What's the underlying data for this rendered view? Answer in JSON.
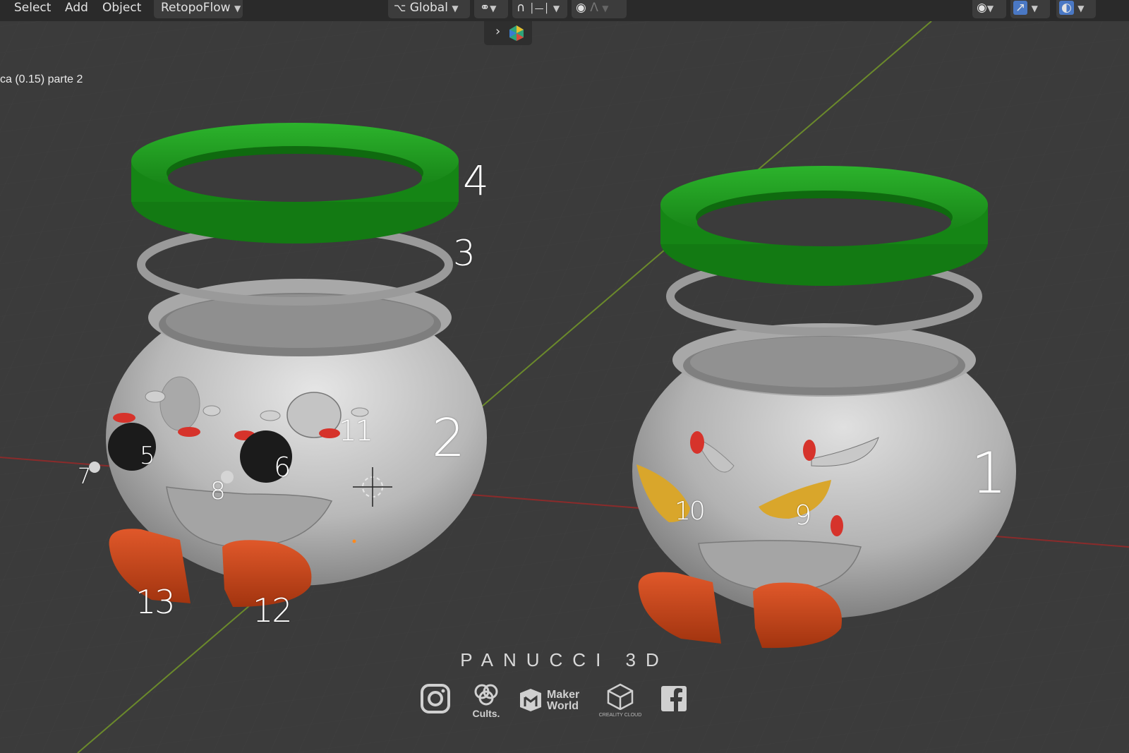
{
  "toolbar": {
    "menu": [
      "Select",
      "Add",
      "Object"
    ],
    "addon_menu": "RetopoFlow",
    "transform_orientation": "Global"
  },
  "viewport": {
    "overlay_text": "ca (0.15) parte 2"
  },
  "annotations": [
    "4",
    "3",
    "2",
    "5",
    "11",
    "6",
    "7",
    "8",
    "13",
    "12",
    "1",
    "10",
    "9"
  ],
  "watermark": {
    "brand": "PANUCCI 3D",
    "cults_label": "Cults.",
    "makerworld_line1": "Maker",
    "makerworld_line2": "World",
    "creality_label": "CREALITY CLOUD"
  },
  "colors": {
    "background": "#3b3b3b",
    "header": "#2a2a2a",
    "ring_green": "#1f9a1f",
    "body_gray": "#bdbdbd",
    "feet_orange": "#c9461c",
    "eye_yellow": "#d9a62b",
    "eye_black": "#1a1a1a",
    "x_axis": "#8a2b2b",
    "y_axis": "#6b8a2b"
  },
  "icons": [
    "transform-icon",
    "pivot-icon",
    "snap-icon",
    "proportional-icon",
    "falloff-icon",
    "visibility-icon",
    "gizmo-icon",
    "overlay-icon",
    "gem-icon",
    "instagram-icon",
    "cults-icon",
    "makerworld-icon",
    "creality-icon",
    "facebook-icon"
  ]
}
